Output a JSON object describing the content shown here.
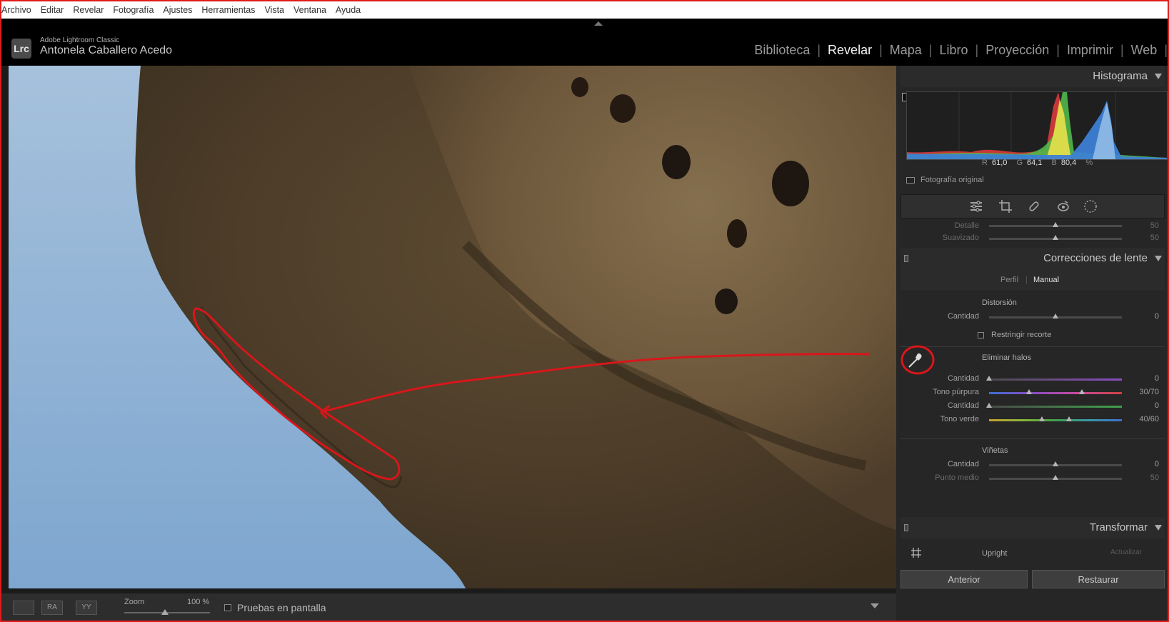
{
  "menu": [
    "Archivo",
    "Editar",
    "Revelar",
    "Fotografía",
    "Ajustes",
    "Herramientas",
    "Vista",
    "Ventana",
    "Ayuda"
  ],
  "app": {
    "logo": "Lrc",
    "name": "Adobe Lightroom Classic",
    "user": "Antonela Caballero Acedo"
  },
  "modules": [
    {
      "label": "Biblioteca",
      "active": false
    },
    {
      "label": "Revelar",
      "active": true
    },
    {
      "label": "Mapa",
      "active": false
    },
    {
      "label": "Libro",
      "active": false
    },
    {
      "label": "Proyección",
      "active": false
    },
    {
      "label": "Imprimir",
      "active": false
    },
    {
      "label": "Web",
      "active": false
    }
  ],
  "toolbar": {
    "zoom_label": "Zoom",
    "zoom_value": "100 %",
    "soft_proof": "Pruebas en pantalla"
  },
  "histogram": {
    "title": "Histograma",
    "r_label": "R",
    "r_value": "61,0",
    "g_label": "G",
    "g_value": "64,1",
    "b_label": "B",
    "b_value": "80,4",
    "unit": "%",
    "original_photo": "Fotografía original"
  },
  "detail": {
    "detalle": "Detalle",
    "detalle_value": "50",
    "suavizado": "Suavizado",
    "suavizado_value": "50"
  },
  "lens": {
    "title": "Correcciones de lente",
    "tab_profile": "Perfil",
    "tab_manual": "Manual",
    "distortion": "Distorsión",
    "amount": "Cantidad",
    "distortion_value": "0",
    "constrain_crop": "Restringir recorte",
    "defringe": "Eliminar halos",
    "purple_amount_value": "0",
    "purple_hue": "Tono púrpura",
    "purple_hue_value": "30/70",
    "green_amount_value": "0",
    "green_hue": "Tono verde",
    "green_hue_value": "40/60",
    "vignetting": "Viñetas",
    "vignetting_amount_value": "0",
    "midpoint": "Punto medio",
    "midpoint_value": "50"
  },
  "transform": {
    "title": "Transformar",
    "upright": "Upright",
    "update": "Actualizar"
  },
  "buttons": {
    "previous": "Anterior",
    "reset": "Restaurar"
  },
  "sliders": {
    "detalle": 0.5,
    "suavizado": 0.5,
    "distortion": 0.5,
    "purple_amount": 0,
    "purple_hue": [
      0.3,
      0.7
    ],
    "green_amount": 0,
    "green_hue": [
      0.4,
      0.6
    ],
    "vignette_amount": 0.5,
    "midpoint": 0.5
  }
}
